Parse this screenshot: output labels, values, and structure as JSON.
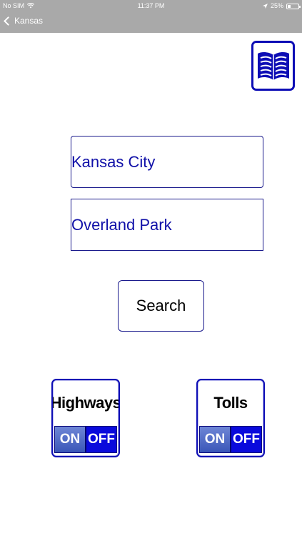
{
  "status_bar": {
    "carrier": "No SIM",
    "time": "11:37 PM",
    "battery_percent": "25%",
    "wifi_icon": "wifi-icon",
    "location_icon": "location-arrow-icon"
  },
  "nav": {
    "back_label": "Kansas"
  },
  "book_button": {
    "icon": "open-book-icon"
  },
  "form": {
    "origin_value": "Kansas City",
    "destination_value": "Overland Park",
    "search_label": "Search"
  },
  "toggles": {
    "highways": {
      "title": "Highways",
      "on_label": "ON",
      "off_label": "OFF",
      "selected": "OFF"
    },
    "tolls": {
      "title": "Tolls",
      "on_label": "ON",
      "off_label": "OFF",
      "selected": "OFF"
    }
  },
  "colors": {
    "accent": "#0d0db5",
    "nav_background": "#a9a9a9",
    "input_text": "#1010a8"
  }
}
